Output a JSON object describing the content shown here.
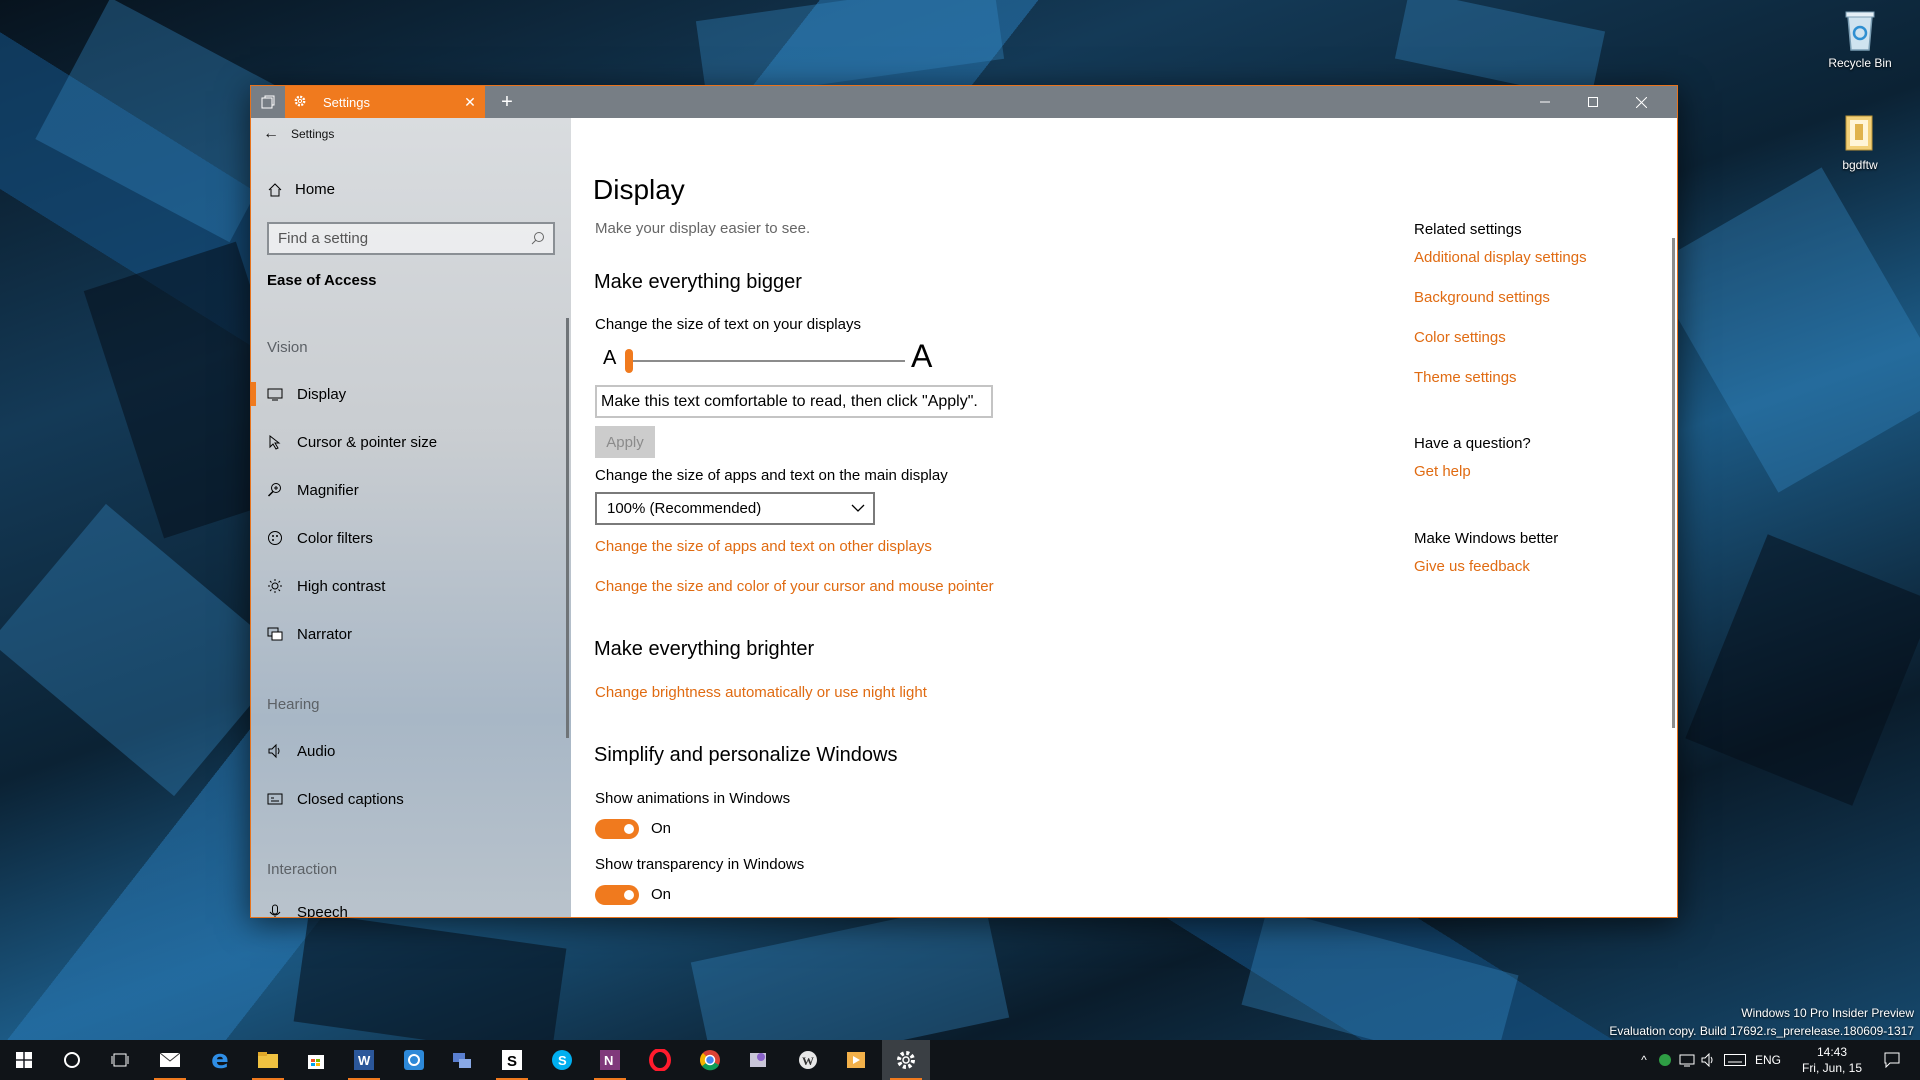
{
  "desktop": {
    "icons": [
      {
        "label": "Recycle Bin",
        "icon": "recycle-bin-icon"
      },
      {
        "label": "bgdftw",
        "icon": "folder-icon"
      }
    ],
    "watermark_line1": "Windows 10 Pro Insider Preview",
    "watermark_line2": "Evaluation copy. Build 17692.rs_prerelease.180609-1317"
  },
  "window": {
    "tab_title": "Settings",
    "accent": "#f07a1e"
  },
  "sidebar": {
    "header": "Settings",
    "home": "Home",
    "search_placeholder": "Find a setting",
    "section_title": "Ease of Access",
    "groups": {
      "vision": "Vision",
      "hearing": "Hearing",
      "interaction": "Interaction"
    },
    "items": [
      {
        "label": "Display",
        "icon": "display-icon",
        "active": true
      },
      {
        "label": "Cursor & pointer size",
        "icon": "cursor-icon"
      },
      {
        "label": "Magnifier",
        "icon": "magnifier-icon"
      },
      {
        "label": "Color filters",
        "icon": "color-filters-icon"
      },
      {
        "label": "High contrast",
        "icon": "high-contrast-icon"
      },
      {
        "label": "Narrator",
        "icon": "narrator-icon"
      },
      {
        "label": "Audio",
        "icon": "audio-icon"
      },
      {
        "label": "Closed captions",
        "icon": "closed-captions-icon"
      },
      {
        "label": "Speech",
        "icon": "microphone-icon"
      }
    ]
  },
  "main": {
    "title": "Display",
    "subtitle": "Make your display easier to see.",
    "bigger": {
      "heading": "Make everything bigger",
      "text_size_label": "Change the size of text on your displays",
      "slider_small": "A",
      "slider_large": "A",
      "slider_value_percent": 0,
      "preview_text": "Make this text comfortable to read, then click \"Apply\".",
      "apply": "Apply",
      "scale_label": "Change the size of apps and text on the main display",
      "scale_value": "100% (Recommended)",
      "link_other_displays": "Change the size of apps and text on other displays",
      "link_cursor": "Change the size and color of your cursor and mouse pointer"
    },
    "brighter": {
      "heading": "Make everything brighter",
      "link_brightness": "Change brightness automatically or use night light"
    },
    "simplify": {
      "heading": "Simplify and personalize Windows",
      "animations_label": "Show animations in Windows",
      "animations_state": "On",
      "transparency_label": "Show transparency in Windows",
      "transparency_state": "On"
    }
  },
  "related": {
    "heading": "Related settings",
    "links": [
      "Additional display settings",
      "Background settings",
      "Color settings",
      "Theme settings"
    ],
    "question_heading": "Have a question?",
    "get_help": "Get help",
    "better_heading": "Make Windows better",
    "feedback": "Give us feedback"
  },
  "taskbar": {
    "apps": [
      "start-icon",
      "cortana-icon",
      "task-view-icon",
      "mail-icon",
      "edge-icon",
      "file-explorer-icon",
      "store-icon",
      "word-icon",
      "app-icon",
      "network-app-icon",
      "sway-icon",
      "skype-icon",
      "onenote-icon",
      "opera-icon",
      "chrome-icon",
      "paint-icon",
      "wordpress-icon",
      "media-icon",
      "settings-icon"
    ],
    "language": "ENG",
    "time": "14:43",
    "date": "Fri, Jun, 15"
  }
}
